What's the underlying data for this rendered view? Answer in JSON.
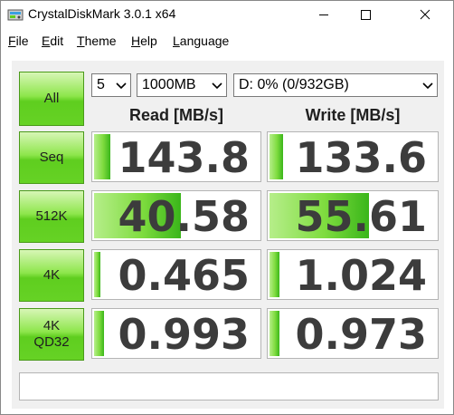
{
  "window": {
    "title": "CrystalDiskMark 3.0.1 x64"
  },
  "menu": {
    "file": {
      "mnemonic": "F",
      "rest": "ile"
    },
    "edit": {
      "mnemonic": "E",
      "rest": "dit"
    },
    "theme": {
      "mnemonic": "T",
      "rest": "heme"
    },
    "help": {
      "mnemonic": "H",
      "rest": "elp"
    },
    "language": {
      "mnemonic": "L",
      "rest": "anguage"
    }
  },
  "controls": {
    "all_label": "All",
    "count": "5",
    "size": "1000MB",
    "drive": "D: 0% (0/932GB)"
  },
  "headers": {
    "read": "Read [MB/s]",
    "write": "Write [MB/s]"
  },
  "tests": [
    {
      "label_line1": "Seq",
      "label_line2": "",
      "read": "143.8",
      "write": "133.6",
      "read_level": 0.1,
      "write_level": 0.08
    },
    {
      "label_line1": "512K",
      "label_line2": "",
      "read": "40.58",
      "write": "55.61",
      "read_level": 0.53,
      "write_level": 0.6
    },
    {
      "label_line1": "4K",
      "label_line2": "",
      "read": "0.465",
      "write": "1.024",
      "read_level": 0.04,
      "write_level": 0.06
    },
    {
      "label_line1": "4K",
      "label_line2": "QD32",
      "read": "0.993",
      "write": "0.973",
      "read_level": 0.06,
      "write_level": 0.06
    }
  ],
  "comment": "",
  "colors": {
    "button_green": "#66d225",
    "bar_green": "#3ab61a",
    "value_text": "#3c3c3c"
  },
  "icons": {
    "app": "crystaldiskmark-icon",
    "minimize": "minimize-icon",
    "maximize": "maximize-icon",
    "close": "close-icon",
    "dropdown": "chevron-down-icon"
  }
}
